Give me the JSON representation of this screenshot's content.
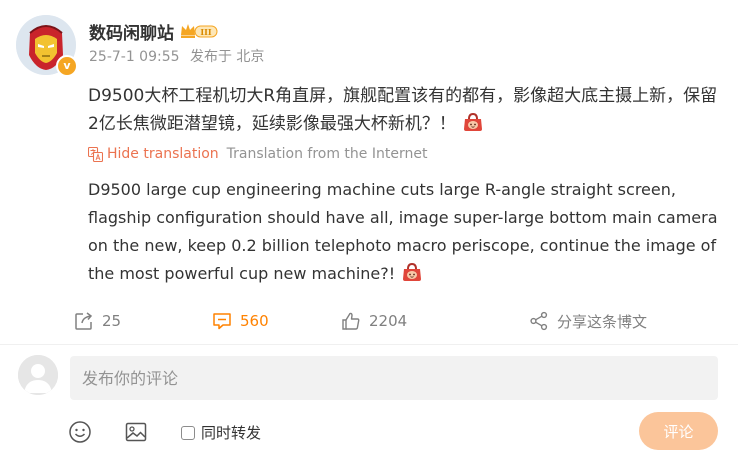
{
  "post": {
    "username": "数码闲聊站",
    "vip_level": "III",
    "verified_mark": "v",
    "timestamp": "25-7-1 09:55",
    "location": "发布于 北京",
    "text": "D9500大杯工程机切大R角直屏，旗舰配置该有的都有，影像超大底主摄上新，保留2亿长焦微距潜望镜，延续影像最强大杯新机？！",
    "emoji": "bag-emoji"
  },
  "translation": {
    "toggle_label": "Hide translation",
    "source": "Translation from the Internet",
    "text": "D9500 large cup engineering machine cuts large R-angle straight screen, flagship configuration should have all, image super-large bottom main camera on the new, keep 0.2 billion telephoto macro periscope, continue the image of the most powerful cup new machine?!"
  },
  "actions": {
    "repost_count": "25",
    "comment_count": "560",
    "like_count": "2204",
    "share_label": "分享这条博文"
  },
  "comment_box": {
    "placeholder": "发布你的评论",
    "forward_label": "同时转发",
    "submit_label": "评论"
  },
  "colors": {
    "accent": "#ff8200",
    "translate_link": "#eb7350",
    "submit_disabled": "#fbc59a",
    "muted": "#939393"
  }
}
